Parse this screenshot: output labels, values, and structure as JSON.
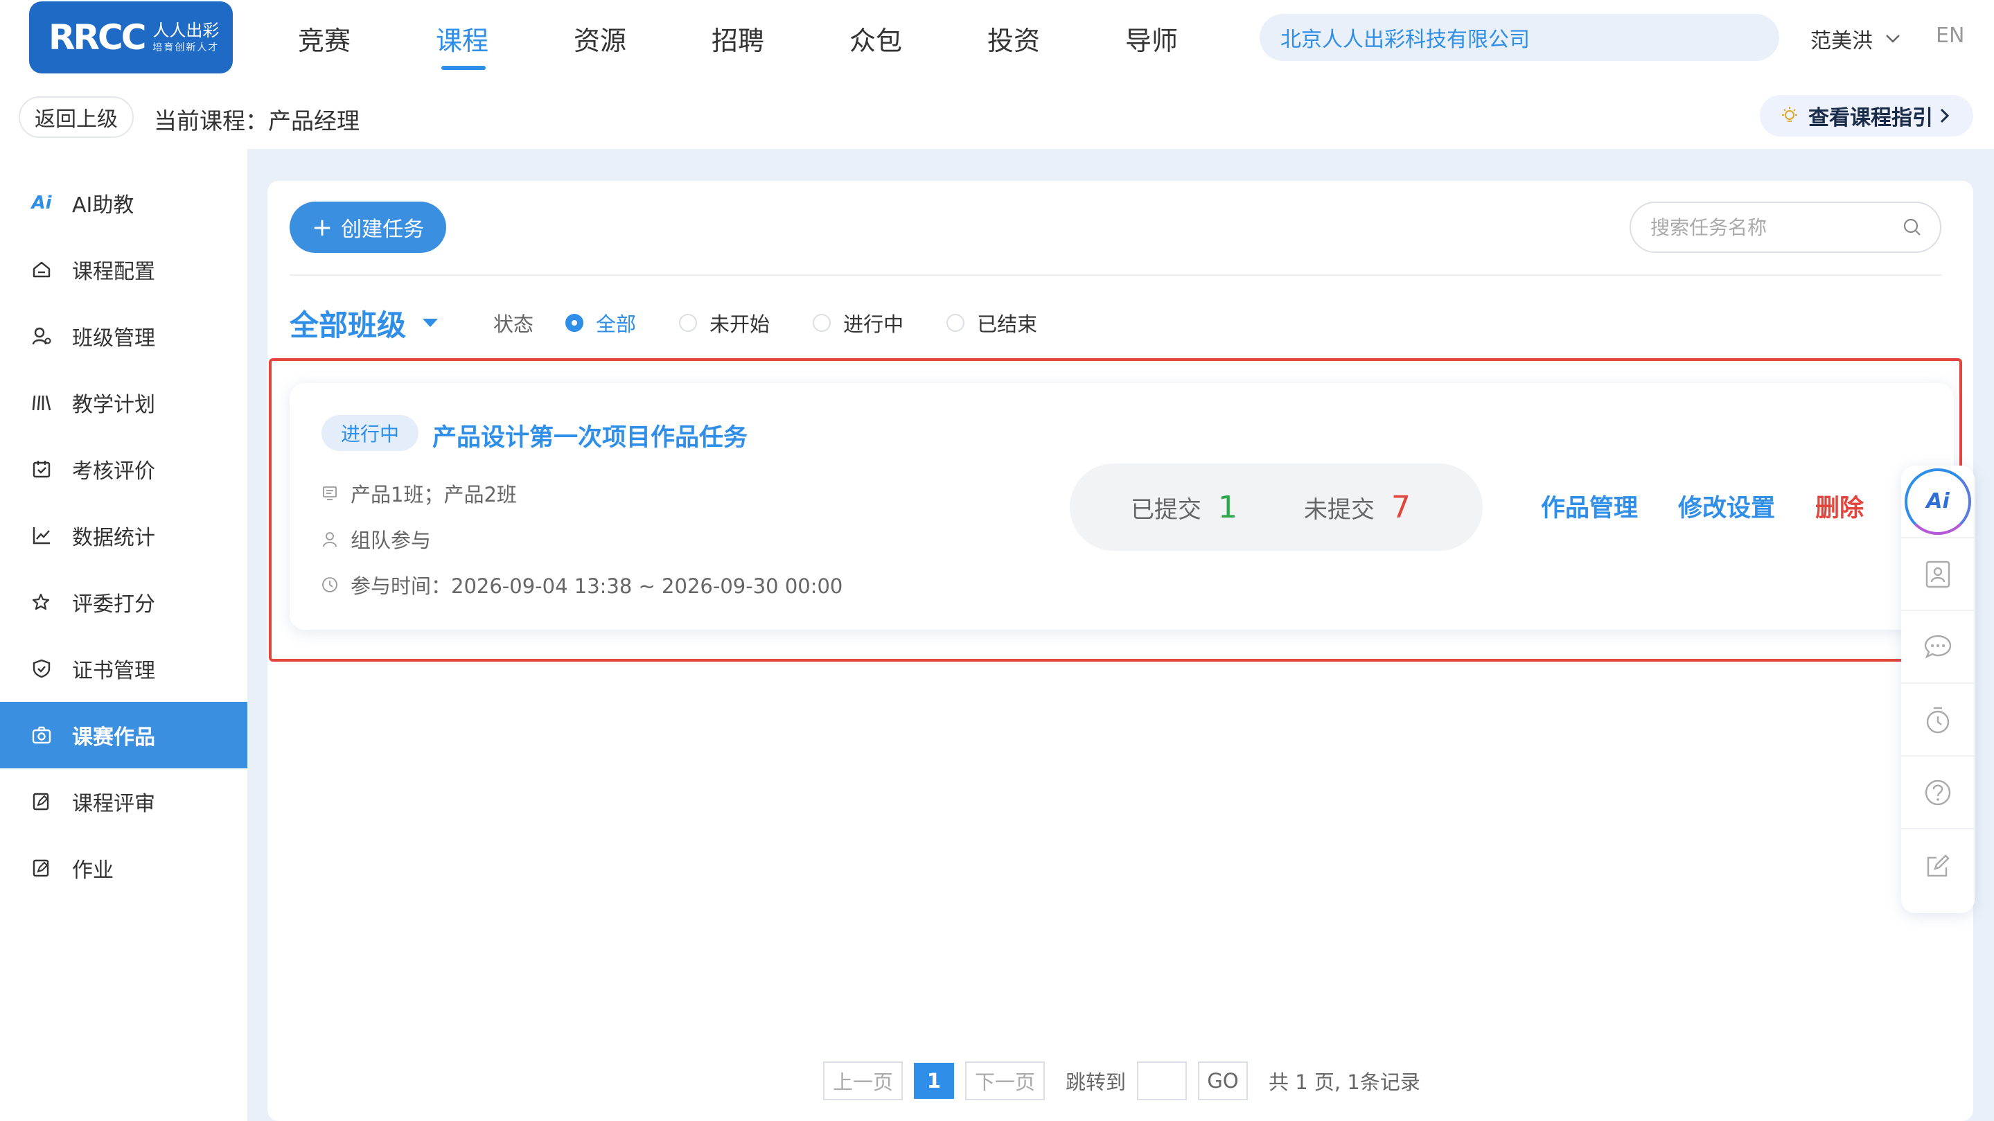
{
  "logo": {
    "main": "RRCC",
    "cn": "人人出彩",
    "sub": "培育创新人才"
  },
  "nav": {
    "items": [
      {
        "label": "竞赛"
      },
      {
        "label": "课程"
      },
      {
        "label": "资源"
      },
      {
        "label": "招聘"
      },
      {
        "label": "众包"
      },
      {
        "label": "投资"
      },
      {
        "label": "导师"
      }
    ],
    "active": "课程",
    "company": "北京人人出彩科技有限公司",
    "user": "范美洪",
    "lang": "EN"
  },
  "subbar": {
    "back_label": "返回上级",
    "current_course": "当前课程：产品经理",
    "guide_label": "查看课程指引"
  },
  "sidebar": {
    "items": [
      {
        "label": "AI助教",
        "icon": "ai-icon"
      },
      {
        "label": "课程配置",
        "icon": "home-icon"
      },
      {
        "label": "班级管理",
        "icon": "user-gear-icon"
      },
      {
        "label": "教学计划",
        "icon": "books-icon"
      },
      {
        "label": "考核评价",
        "icon": "calendar-check-icon"
      },
      {
        "label": "数据统计",
        "icon": "line-chart-icon"
      },
      {
        "label": "评委打分",
        "icon": "star-score-icon"
      },
      {
        "label": "证书管理",
        "icon": "shield-check-icon"
      },
      {
        "label": "课赛作品",
        "icon": "camera-icon"
      },
      {
        "label": "课程评审",
        "icon": "edit-review-icon"
      },
      {
        "label": "作业",
        "icon": "homework-icon"
      }
    ],
    "active": "课赛作品"
  },
  "toolbar": {
    "create_label": "创建任务",
    "search_placeholder": "搜索任务名称",
    "search_value": ""
  },
  "filter": {
    "class_select": "全部班级",
    "status_label": "状态",
    "options": [
      {
        "label": "全部",
        "checked": true
      },
      {
        "label": "未开始",
        "checked": false
      },
      {
        "label": "进行中",
        "checked": false
      },
      {
        "label": "已结束",
        "checked": false
      }
    ]
  },
  "task": {
    "status": "进行中",
    "title": "产品设计第一次项目作品任务",
    "classes": "产品1班；产品2班",
    "mode": "组队参与",
    "time": "参与时间：2026-09-04 13:38 ~ 2026-09-30 00:00",
    "submitted_label": "已提交",
    "submitted_count": "1",
    "unsubmitted_label": "未提交",
    "unsubmitted_count": "7",
    "actions": {
      "manage": "作品管理",
      "settings": "修改设置",
      "delete": "删除"
    }
  },
  "floatbar": {
    "ai_label": "Ai",
    "items": [
      "ai-assistant-icon",
      "contact-card-icon",
      "chat-icon",
      "timer-icon",
      "help-icon",
      "edit-icon"
    ]
  },
  "pagination": {
    "prev": "上一页",
    "current": "1",
    "next": "下一页",
    "jump_label": "跳转到",
    "go": "GO",
    "total": "共 1 页, 1条记录"
  },
  "colors": {
    "accent": "#2e8ee8",
    "sidebar_active": "#3a8fe0",
    "danger": "#e2453c",
    "success": "#2ea84a",
    "logo_bg": "#1f6ac4"
  }
}
